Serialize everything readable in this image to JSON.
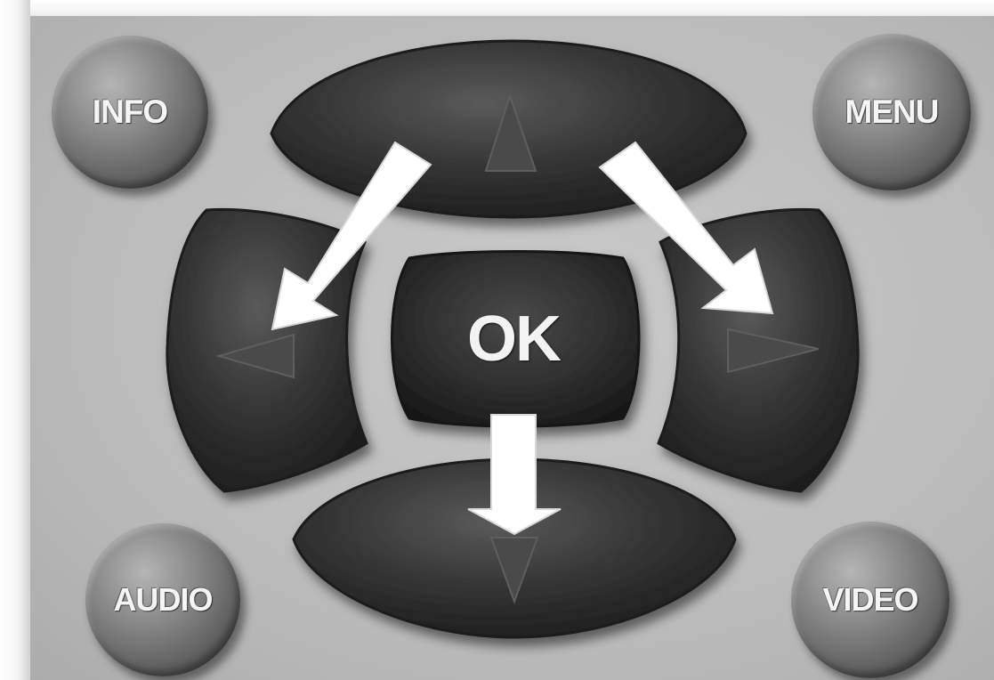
{
  "buttons": {
    "info": "INFO",
    "menu": "MENU",
    "audio": "AUDIO",
    "video": "VIDEO",
    "ok": "OK"
  },
  "dpad": {
    "up_icon": "triangle-up",
    "down_icon": "triangle-down",
    "left_icon": "triangle-left",
    "right_icon": "triangle-right"
  },
  "annotation_arrows": [
    "arrow-down-left",
    "arrow-down-right",
    "arrow-down"
  ],
  "colors": {
    "panel": "#c2c2c2",
    "dark_button": "#2f2f2f",
    "arrow": "#ffffff",
    "label": "#f5f5f5"
  }
}
